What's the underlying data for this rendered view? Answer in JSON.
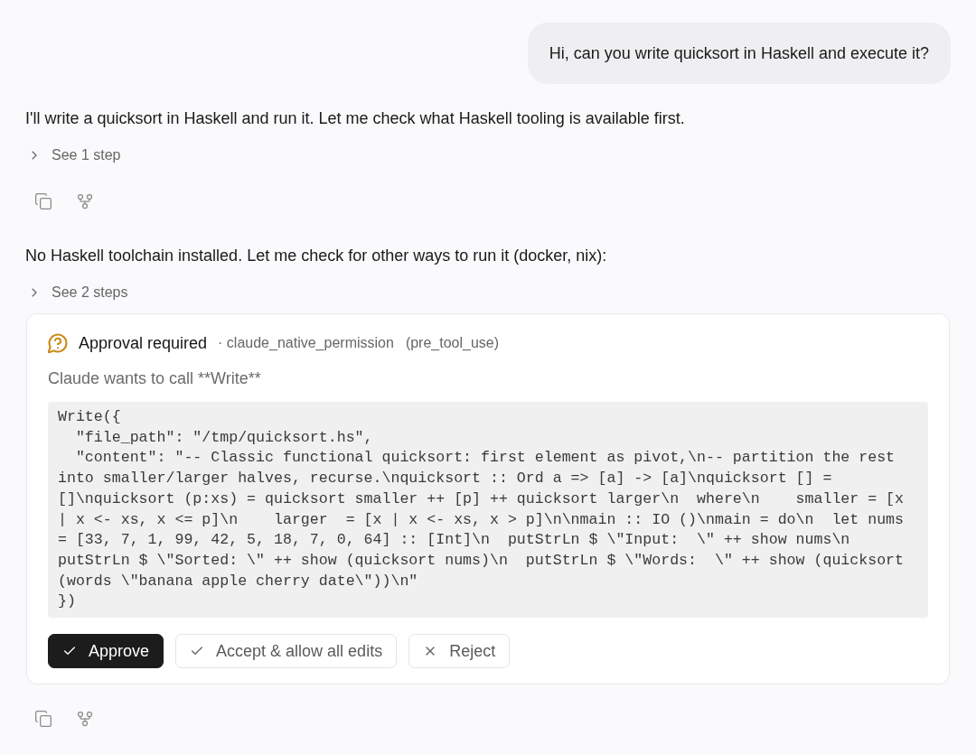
{
  "user_message": {
    "text": "Hi, can you write quicksort in Haskell and execute it?"
  },
  "assistant": [
    {
      "kind": "text",
      "text": "I'll write a quicksort in Haskell and run it. Let me check what Haskell tooling is available first."
    },
    {
      "kind": "steps",
      "label": "See 1 step",
      "expanded": false
    },
    {
      "kind": "actions"
    },
    {
      "kind": "text",
      "text": "No Haskell toolchain installed. Let me check for other ways to run it (docker, nix):"
    },
    {
      "kind": "steps",
      "label": "See 2 steps",
      "expanded": false
    },
    {
      "kind": "approval",
      "title": "Approval required",
      "source": "· claude_native_permission",
      "tag": "(pre_tool_use)",
      "message": "Claude wants to call **Write**",
      "code_lines": [
        "Write({",
        "  \"file_path\": \"/tmp/quicksort.hs\",",
        "  \"content\": \"-- Classic functional quicksort: first element as pivot,\\n-- partition the rest",
        "into smaller/larger halves, recurse.\\nquicksort :: Ord a => [a] -> [a]\\nquicksort [] =",
        "[]\\nquicksort (p:xs) = quicksort smaller ++ [p] ++ quicksort larger\\n  where\\n    smaller = [x",
        "| x <- xs, x <= p]\\n    larger  = [x | x <- xs, x > p]\\n\\nmain :: IO ()\\nmain = do\\n  let nums",
        "= [33, 7, 1, 99, 42, 5, 18, 7, 0, 64] :: [Int]\\n  putStrLn $ \\\"Input:  \\\" ++ show nums\\n",
        "putStrLn $ \\\"Sorted: \\\" ++ show (quicksort nums)\\n  putStrLn $ \\\"Words:  \\\" ++ show (quicksort",
        "(words \\\"banana apple cherry date\\\"))\\n\"",
        "})"
      ],
      "buttons": [
        {
          "kind": "approve",
          "label": "Approve"
        },
        {
          "kind": "accept",
          "label": "Accept & allow all edits"
        },
        {
          "kind": "reject",
          "label": "Reject"
        }
      ]
    },
    {
      "kind": "actions"
    }
  ]
}
